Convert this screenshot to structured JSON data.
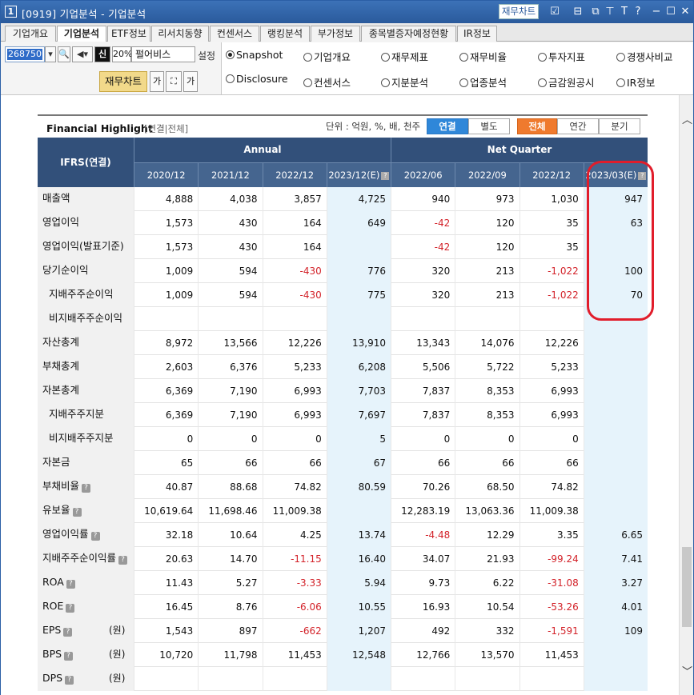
{
  "window": {
    "num": "1",
    "title": "[0919] 기업분석 - 기업분석",
    "fin_chart_btn": "재무차트"
  },
  "tabs": [
    "기업개요",
    "기업분석",
    "ETF정보",
    "리서치동향",
    "컨센서스",
    "랭킹분석",
    "부가정보",
    "종목별증자예정현황",
    "IR정보"
  ],
  "active_tab": 1,
  "controls": {
    "code": "268750",
    "market_badge": "신",
    "percent": "20%",
    "company": "펄어비스",
    "setting": "설정",
    "chart_button": "재무차트"
  },
  "radios": [
    {
      "label": "Snapshot",
      "on": true
    },
    {
      "label": "기업개요",
      "on": false
    },
    {
      "label": "재무제표",
      "on": false
    },
    {
      "label": "재무비율",
      "on": false
    },
    {
      "label": "투자지표",
      "on": false
    },
    {
      "label": "경쟁사비교",
      "on": false
    },
    {
      "label": "Disclosure",
      "on": false
    },
    {
      "label": "컨센서스",
      "on": false
    },
    {
      "label": "지분분석",
      "on": false
    },
    {
      "label": "업종분석",
      "on": false
    },
    {
      "label": "금감원공시",
      "on": false
    },
    {
      "label": "IR정보",
      "on": false
    }
  ],
  "highlight": {
    "title": "Financial Highlight",
    "subtitle": "[연결|전체]",
    "unit": "단위 : 억원, %, 배, 천주",
    "seg1": [
      "연결",
      "별도"
    ],
    "seg2": [
      "전체",
      "연간",
      "분기"
    ]
  },
  "table": {
    "corner": "IFRS(연결)",
    "group_annual": "Annual",
    "group_quarter": "Net Quarter",
    "columns": [
      "2020/12",
      "2021/12",
      "2022/12",
      "2023/12(E)",
      "2022/06",
      "2022/09",
      "2022/12",
      "2023/03(E)"
    ],
    "rows": [
      {
        "label": "매출액",
        "values": [
          "4,888",
          "4,038",
          "3,857",
          "4,725",
          "940",
          "973",
          "1,030",
          "947"
        ]
      },
      {
        "label": "영업이익",
        "values": [
          "1,573",
          "430",
          "164",
          "649",
          "-42",
          "120",
          "35",
          "63"
        ]
      },
      {
        "label": "영업이익(발표기준)",
        "values": [
          "1,573",
          "430",
          "164",
          "",
          "-42",
          "120",
          "35",
          ""
        ]
      },
      {
        "label": "당기순이익",
        "values": [
          "1,009",
          "594",
          "-430",
          "776",
          "320",
          "213",
          "-1,022",
          "100"
        ]
      },
      {
        "label": "지배주주순이익",
        "values": [
          "1,009",
          "594",
          "-430",
          "775",
          "320",
          "213",
          "-1,022",
          "70"
        ]
      },
      {
        "label": "비지배주주순이익",
        "values": [
          "",
          "",
          "",
          "",
          "",
          "",
          "",
          ""
        ]
      },
      {
        "label": "자산총계",
        "values": [
          "8,972",
          "13,566",
          "12,226",
          "13,910",
          "13,343",
          "14,076",
          "12,226",
          ""
        ]
      },
      {
        "label": "부채총계",
        "values": [
          "2,603",
          "6,376",
          "5,233",
          "6,208",
          "5,506",
          "5,722",
          "5,233",
          ""
        ]
      },
      {
        "label": "자본총계",
        "values": [
          "6,369",
          "7,190",
          "6,993",
          "7,703",
          "7,837",
          "8,353",
          "6,993",
          ""
        ]
      },
      {
        "label": "지배주주지분",
        "values": [
          "6,369",
          "7,190",
          "6,993",
          "7,697",
          "7,837",
          "8,353",
          "6,993",
          ""
        ]
      },
      {
        "label": "비지배주주지분",
        "values": [
          "0",
          "0",
          "0",
          "5",
          "0",
          "0",
          "0",
          ""
        ]
      },
      {
        "label": "자본금",
        "values": [
          "65",
          "66",
          "66",
          "67",
          "66",
          "66",
          "66",
          ""
        ]
      },
      {
        "label": "부채비율",
        "values": [
          "40.87",
          "88.68",
          "74.82",
          "80.59",
          "70.26",
          "68.50",
          "74.82",
          ""
        ]
      },
      {
        "label": "유보율",
        "values": [
          "10,619.64",
          "11,698.46",
          "11,009.38",
          "",
          "12,283.19",
          "13,063.36",
          "11,009.38",
          ""
        ]
      },
      {
        "label": "영업이익률",
        "values": [
          "32.18",
          "10.64",
          "4.25",
          "13.74",
          "-4.48",
          "12.29",
          "3.35",
          "6.65"
        ]
      },
      {
        "label": "지배주주순이익률",
        "values": [
          "20.63",
          "14.70",
          "-11.15",
          "16.40",
          "34.07",
          "21.93",
          "-99.24",
          "7.41"
        ]
      },
      {
        "label": "ROA",
        "values": [
          "11.43",
          "5.27",
          "-3.33",
          "5.94",
          "9.73",
          "6.22",
          "-31.08",
          "3.27"
        ]
      },
      {
        "label": "ROE",
        "values": [
          "16.45",
          "8.76",
          "-6.06",
          "10.55",
          "16.93",
          "10.54",
          "-53.26",
          "4.01"
        ]
      },
      {
        "label": "EPS",
        "unit": "(원)",
        "values": [
          "1,543",
          "897",
          "-662",
          "1,207",
          "492",
          "332",
          "-1,591",
          "109"
        ]
      },
      {
        "label": "BPS",
        "unit": "(원)",
        "values": [
          "10,720",
          "11,798",
          "11,453",
          "12,548",
          "12,766",
          "13,570",
          "11,453",
          ""
        ]
      },
      {
        "label": "DPS",
        "unit": "(원)",
        "values": [
          "",
          "",
          "",
          "",
          "",
          "",
          "",
          ""
        ]
      }
    ]
  }
}
